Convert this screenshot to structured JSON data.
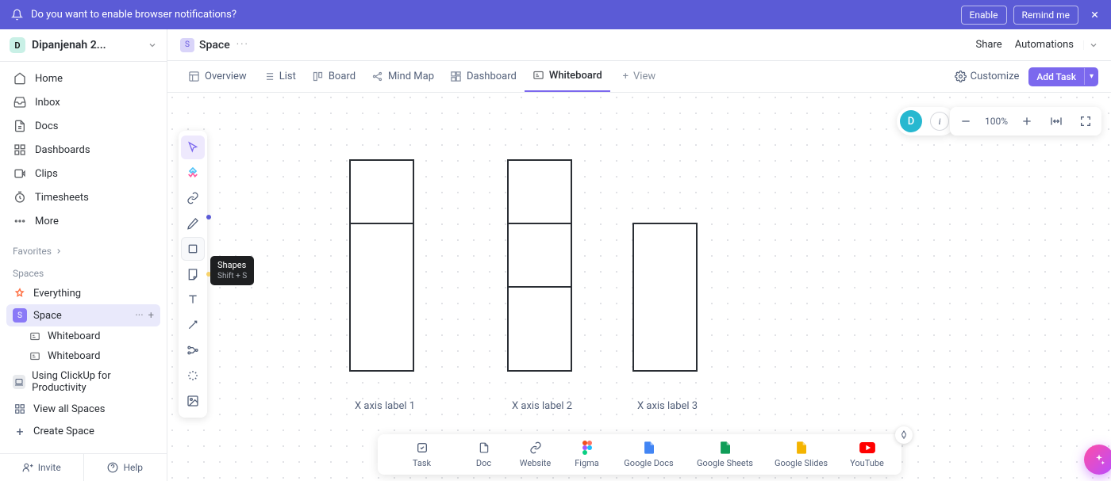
{
  "banner": {
    "message": "Do you want to enable browser notifications?",
    "enable": "Enable",
    "remind": "Remind me"
  },
  "workspace": {
    "initial": "D",
    "name": "Dipanjenah 2...",
    "badge_bg": "#c9f0e6",
    "badge_fg": "#141414"
  },
  "nav": [
    {
      "label": "Home"
    },
    {
      "label": "Inbox"
    },
    {
      "label": "Docs"
    },
    {
      "label": "Dashboards"
    },
    {
      "label": "Clips"
    },
    {
      "label": "Timesheets"
    },
    {
      "label": "More"
    }
  ],
  "sections": {
    "favorites": "Favorites",
    "spaces": "Spaces"
  },
  "spaces": {
    "everything": "Everything",
    "space": {
      "initial": "S",
      "label": "Space",
      "badge_bg": "#8a79f7",
      "badge_fg": "#ffffff"
    },
    "children": [
      "Whiteboard",
      "Whiteboard"
    ],
    "productivity": "Using ClickUp for Productivity",
    "view_all": "View all Spaces",
    "create": "Create Space"
  },
  "footer": {
    "invite": "Invite",
    "help": "Help"
  },
  "breadcrumb": {
    "initial": "S",
    "name": "Space",
    "badge_bg": "#d9d4f9",
    "badge_fg": "#6b5ae0",
    "share": "Share",
    "automations": "Automations"
  },
  "tabs": [
    {
      "label": "Overview"
    },
    {
      "label": "List"
    },
    {
      "label": "Board"
    },
    {
      "label": "Mind Map"
    },
    {
      "label": "Dashboard"
    },
    {
      "label": "Whiteboard"
    },
    {
      "label": "View"
    }
  ],
  "tabs_right": {
    "customize": "Customize",
    "add_task": "Add Task"
  },
  "tooltip": {
    "title": "Shapes",
    "shortcut": "Shift + S"
  },
  "canvas": {
    "labels": [
      "X axis label 1",
      "X axis label 2",
      "X axis label 3"
    ]
  },
  "users": {
    "avatar_initial": "D",
    "avatar_bg": "#27b8d0"
  },
  "zoom": {
    "value": "100%"
  },
  "embed": [
    {
      "label": "Task"
    },
    {
      "label": "Doc"
    },
    {
      "label": "Website"
    },
    {
      "label": "Figma"
    },
    {
      "label": "Google Docs"
    },
    {
      "label": "Google Sheets"
    },
    {
      "label": "Google Slides"
    },
    {
      "label": "YouTube"
    }
  ]
}
